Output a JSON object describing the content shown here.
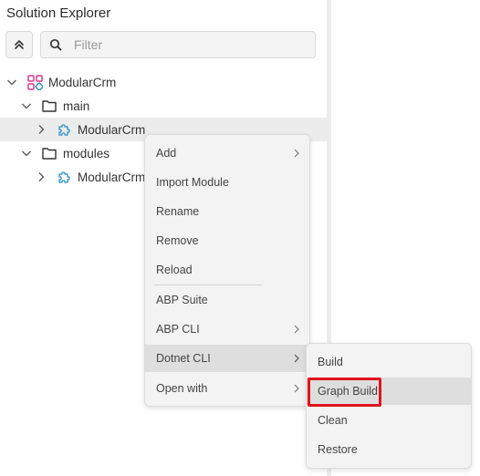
{
  "panel": {
    "title": "Solution Explorer"
  },
  "filter": {
    "placeholder": "Filter",
    "value": ""
  },
  "tree": {
    "root": "ModularCrm",
    "main_folder": "main",
    "main_project": "ModularCrm",
    "modules_folder": "modules",
    "modules_project": "ModularCrm"
  },
  "context_menu": {
    "items": [
      {
        "label": "Add",
        "submenu": true
      },
      {
        "label": "Import Module",
        "submenu": false
      },
      {
        "label": "Rename",
        "submenu": false
      },
      {
        "label": "Remove",
        "submenu": false
      },
      {
        "label": "Reload",
        "submenu": false
      },
      {
        "label": "ABP Suite",
        "submenu": false
      },
      {
        "label": "ABP CLI",
        "submenu": true
      },
      {
        "label": "Dotnet CLI",
        "submenu": true,
        "active": true
      },
      {
        "label": "Open with",
        "submenu": true
      }
    ]
  },
  "sub_menu": {
    "items": [
      {
        "label": "Build"
      },
      {
        "label": "Graph Build",
        "highlighted": true
      },
      {
        "label": "Clean"
      },
      {
        "label": "Restore"
      }
    ]
  },
  "colors": {
    "highlight": "#e0141e",
    "solution_icon": "#d63a8a",
    "project_icon": "#2a8fc7"
  },
  "icons": {
    "collapse": "double-chevron-up-icon",
    "search": "search-icon",
    "solution": "solution-grid-icon",
    "folder": "folder-icon",
    "project": "puzzle-icon",
    "submenu": "chevron-right-icon"
  }
}
